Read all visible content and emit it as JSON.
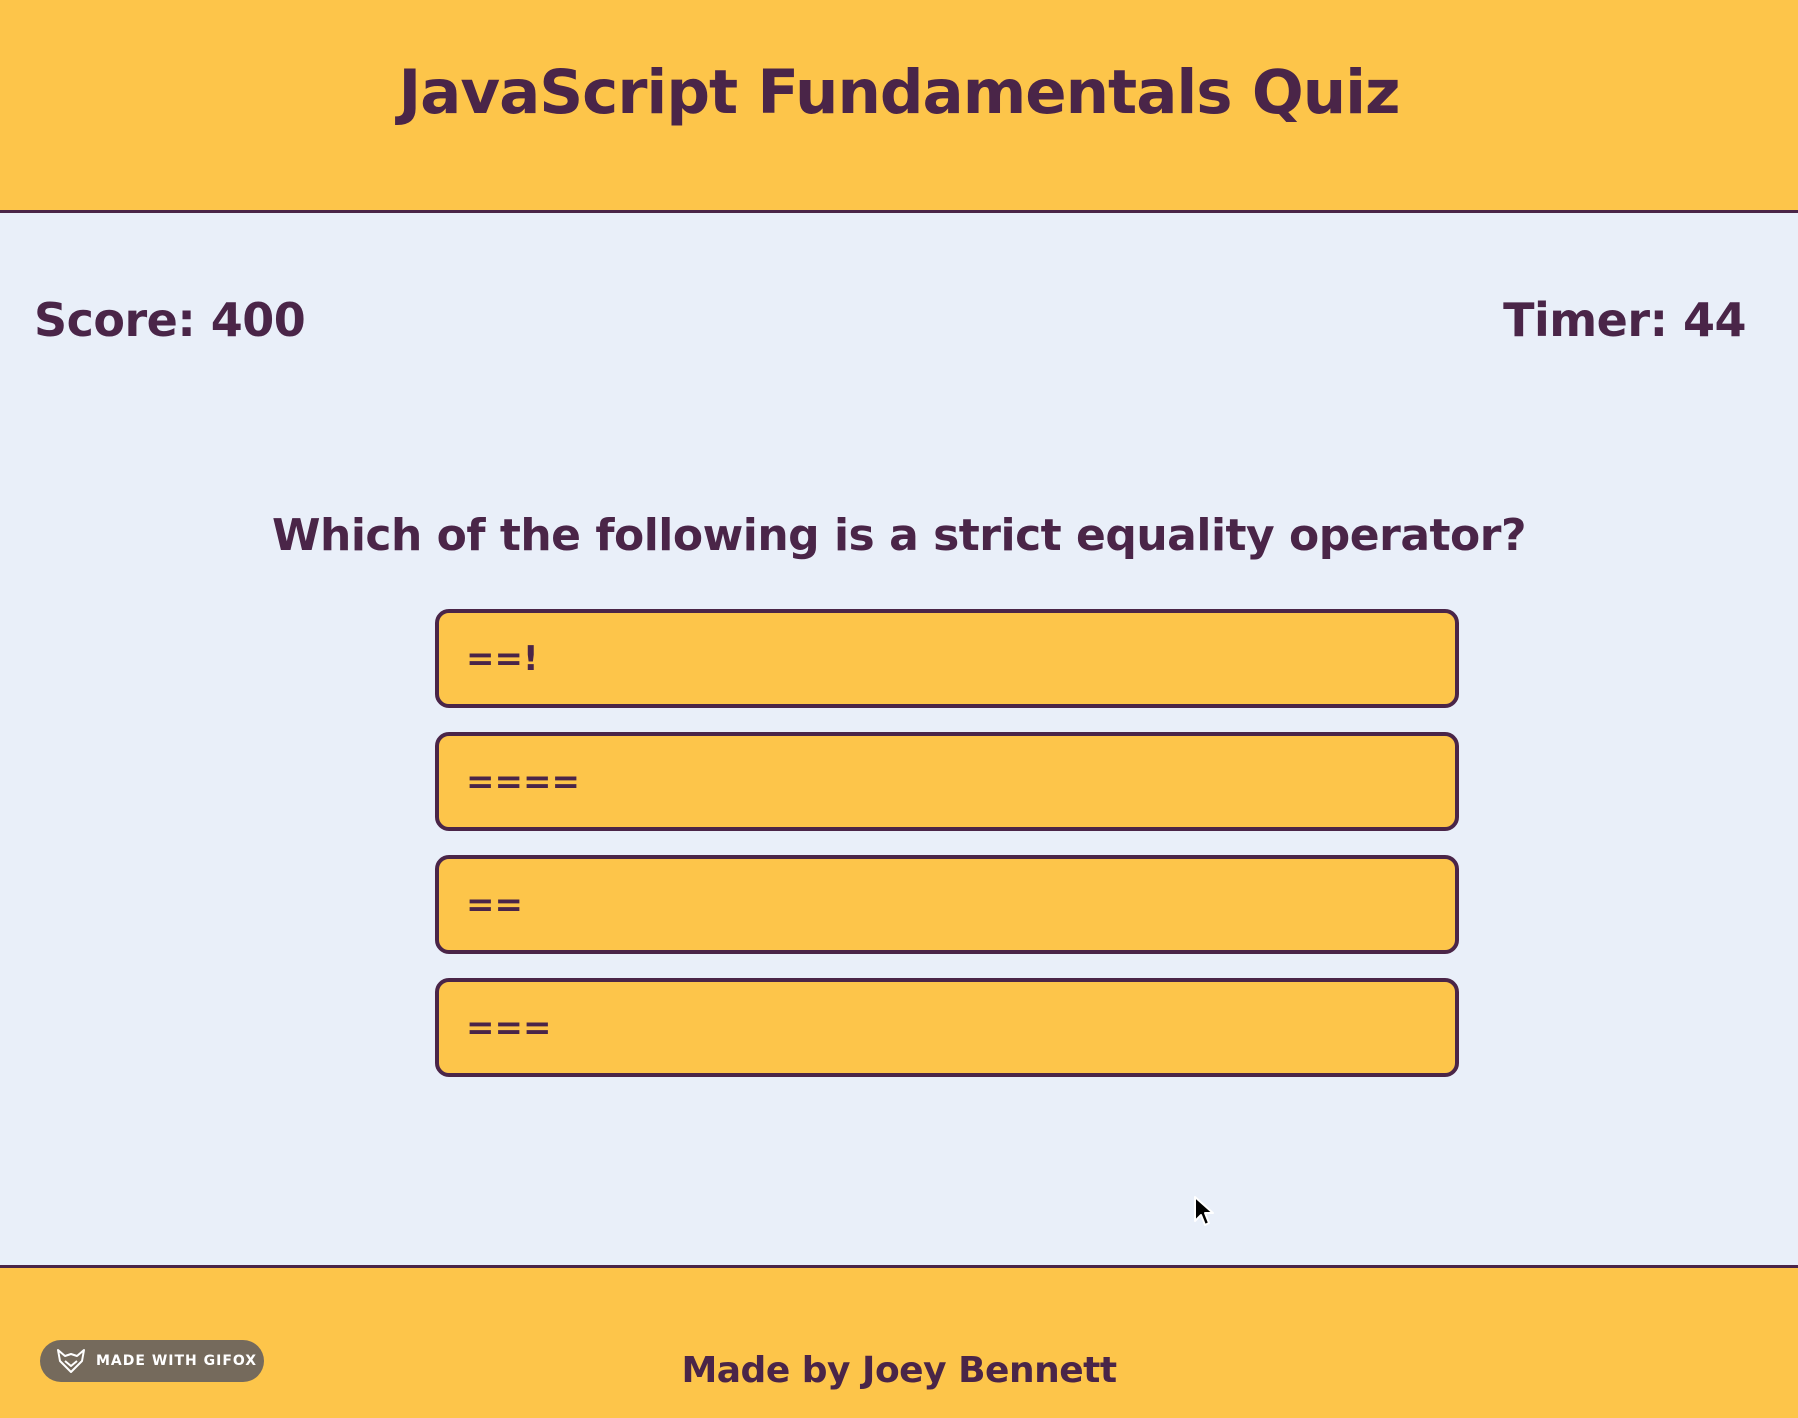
{
  "header": {
    "title": "JavaScript Fundamentals Quiz"
  },
  "stats": {
    "score_label": "Score: 400",
    "timer_label": "Timer: 44"
  },
  "quiz": {
    "question": "Which of the following is a strict equality operator?",
    "answers": [
      "==!",
      "====",
      "==",
      "==="
    ]
  },
  "footer": {
    "credit": "Made by Joey Bennett",
    "badge_label": "MADE WITH GIFOX"
  },
  "colors": {
    "accent": "#fdc54a",
    "text": "#4a2548",
    "background": "#e9eff9"
  },
  "icons": {
    "badge_icon": "fox-icon",
    "pointer": "mouse-cursor-icon"
  }
}
